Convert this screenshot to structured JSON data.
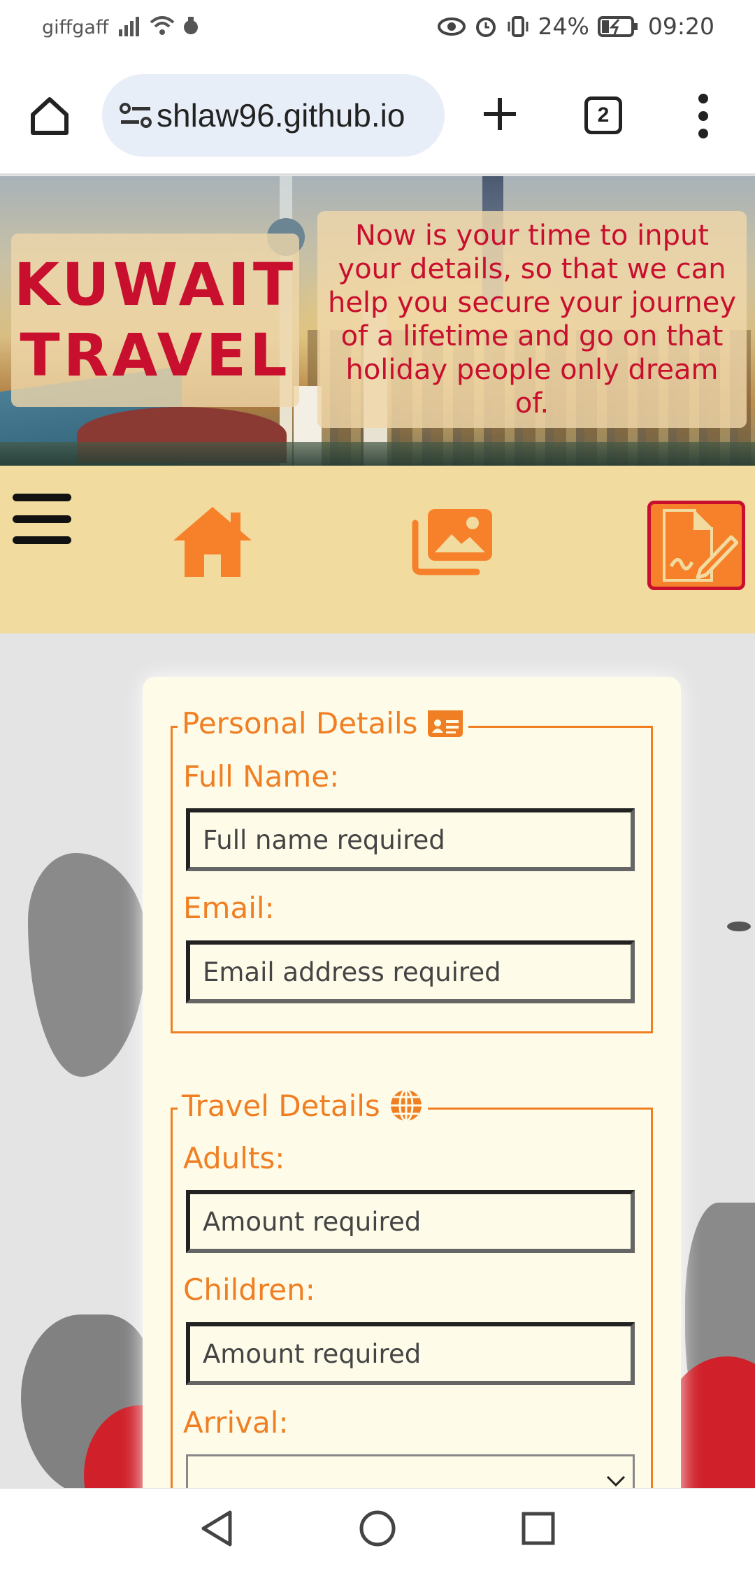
{
  "status_bar": {
    "carrier": "giffgaff",
    "battery": "24%",
    "time": "09:20"
  },
  "browser": {
    "url": "shlaw96.github.io",
    "tab_count": "2"
  },
  "hero": {
    "title_line1": "KUWAIT",
    "title_line2": "TRAVEL",
    "intro": "Now is your time to input your details, so that we can help you secure your journey of a lifetime and go on that holiday people only dream of."
  },
  "nav": {
    "items": [
      "home-icon",
      "gallery-icon",
      "form-icon"
    ],
    "accent": "#f7812b",
    "active_border": "#c8102e"
  },
  "form": {
    "personal": {
      "legend": "Personal Details",
      "full_name_label": "Full Name:",
      "full_name_placeholder": "Full name required",
      "email_label": "Email:",
      "email_placeholder": "Email address required"
    },
    "travel": {
      "legend": "Travel Details",
      "adults_label": "Adults:",
      "adults_placeholder": "Amount required",
      "children_label": "Children:",
      "children_placeholder": "Amount required",
      "arrival_label": "Arrival:"
    }
  },
  "colors": {
    "brand_red": "#c8102e",
    "form_orange": "#f07f24",
    "nav_bg": "#f1db9f",
    "card_bg": "#fefce9"
  }
}
